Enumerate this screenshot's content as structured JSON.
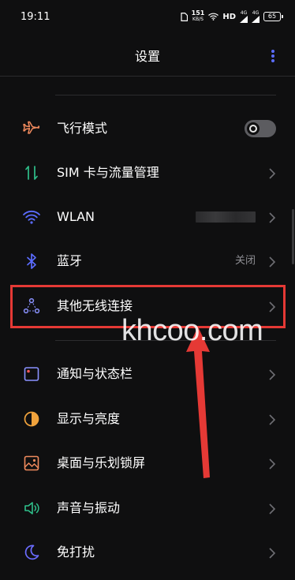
{
  "status_bar": {
    "time": "19:11",
    "net_speed_value": "151",
    "net_speed_unit": "KB/S",
    "hd_label": "HD",
    "signal1_label": "4G",
    "signal2_label": "4G",
    "battery": "65"
  },
  "header": {
    "title": "设置",
    "more_icon": "more-vert-icon"
  },
  "settings_items": [
    {
      "label": "飞行模式",
      "icon": "airplane-icon",
      "control": "toggle",
      "toggle_on": false
    },
    {
      "label": "SIM 卡与流量管理",
      "icon": "sim-traffic-icon",
      "control": "chevron"
    },
    {
      "label": "WLAN",
      "icon": "wifi-icon",
      "control": "chevron"
    },
    {
      "label": "蓝牙",
      "icon": "bluetooth-icon",
      "control": "chevron",
      "value": "关闭"
    },
    {
      "label": "其他无线连接",
      "icon": "wireless-connection-icon",
      "control": "chevron"
    },
    {
      "label": "通知与状态栏",
      "icon": "notification-icon",
      "control": "chevron"
    },
    {
      "label": "显示与亮度",
      "icon": "display-brightness-icon",
      "control": "chevron"
    },
    {
      "label": "桌面与乐划锁屏",
      "icon": "desktop-wallpaper-icon",
      "control": "chevron"
    },
    {
      "label": "声音与振动",
      "icon": "sound-icon",
      "control": "chevron"
    },
    {
      "label": "免打扰",
      "icon": "moon-icon",
      "control": "chevron"
    }
  ],
  "watermark": "khcoo.com",
  "colors": {
    "background": "#0f0f10",
    "highlight": "#e53935",
    "accent_blue": "#5b6cff",
    "accent_orange": "#f08a5d",
    "accent_green": "#2fbf8a"
  }
}
